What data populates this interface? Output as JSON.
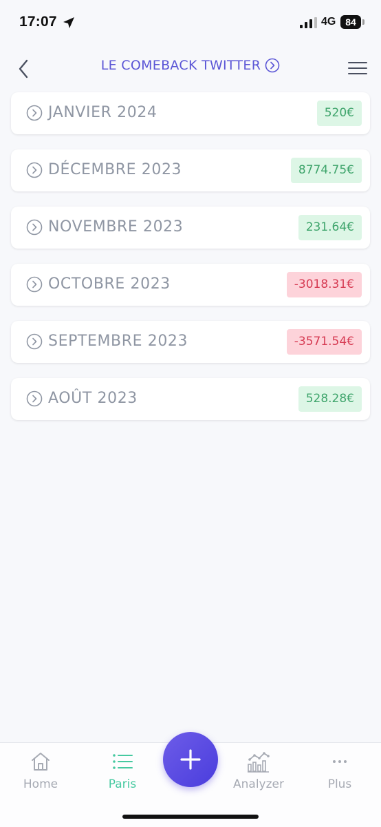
{
  "status_bar": {
    "time": "17:07",
    "network": "4G",
    "battery": "84"
  },
  "header": {
    "title": "LE COMEBACK TWITTER"
  },
  "months": [
    {
      "label": "JANVIER 2024",
      "amount": "520€",
      "status": "positive"
    },
    {
      "label": "DÉCEMBRE 2023",
      "amount": "8774.75€",
      "status": "positive"
    },
    {
      "label": "NOVEMBRE 2023",
      "amount": "231.64€",
      "status": "positive"
    },
    {
      "label": "OCTOBRE 2023",
      "amount": "-3018.31€",
      "status": "negative"
    },
    {
      "label": "SEPTEMBRE 2023",
      "amount": "-3571.54€",
      "status": "negative"
    },
    {
      "label": "AOÛT 2023",
      "amount": "528.28€",
      "status": "positive"
    }
  ],
  "tab_bar": {
    "home": "Home",
    "paris": "Paris",
    "analyzer": "Analyzer",
    "plus": "Plus",
    "active": "paris"
  },
  "colors": {
    "accent": "#5b56d6",
    "positive_bg": "#ddf6e6",
    "positive_text": "#3ea46b",
    "negative_bg": "#fdd3da",
    "negative_text": "#d63a52",
    "active_tab": "#46c9a0"
  },
  "icons": {
    "back": "chevron-left-icon",
    "title": "chevron-circle-right-icon",
    "menu": "hamburger-menu-icon",
    "row": "chevron-circle-right-icon",
    "home": "house-icon",
    "paris": "list-icon",
    "add": "plus-icon",
    "analyzer": "bar-chart-icon",
    "plus": "ellipsis-icon"
  }
}
